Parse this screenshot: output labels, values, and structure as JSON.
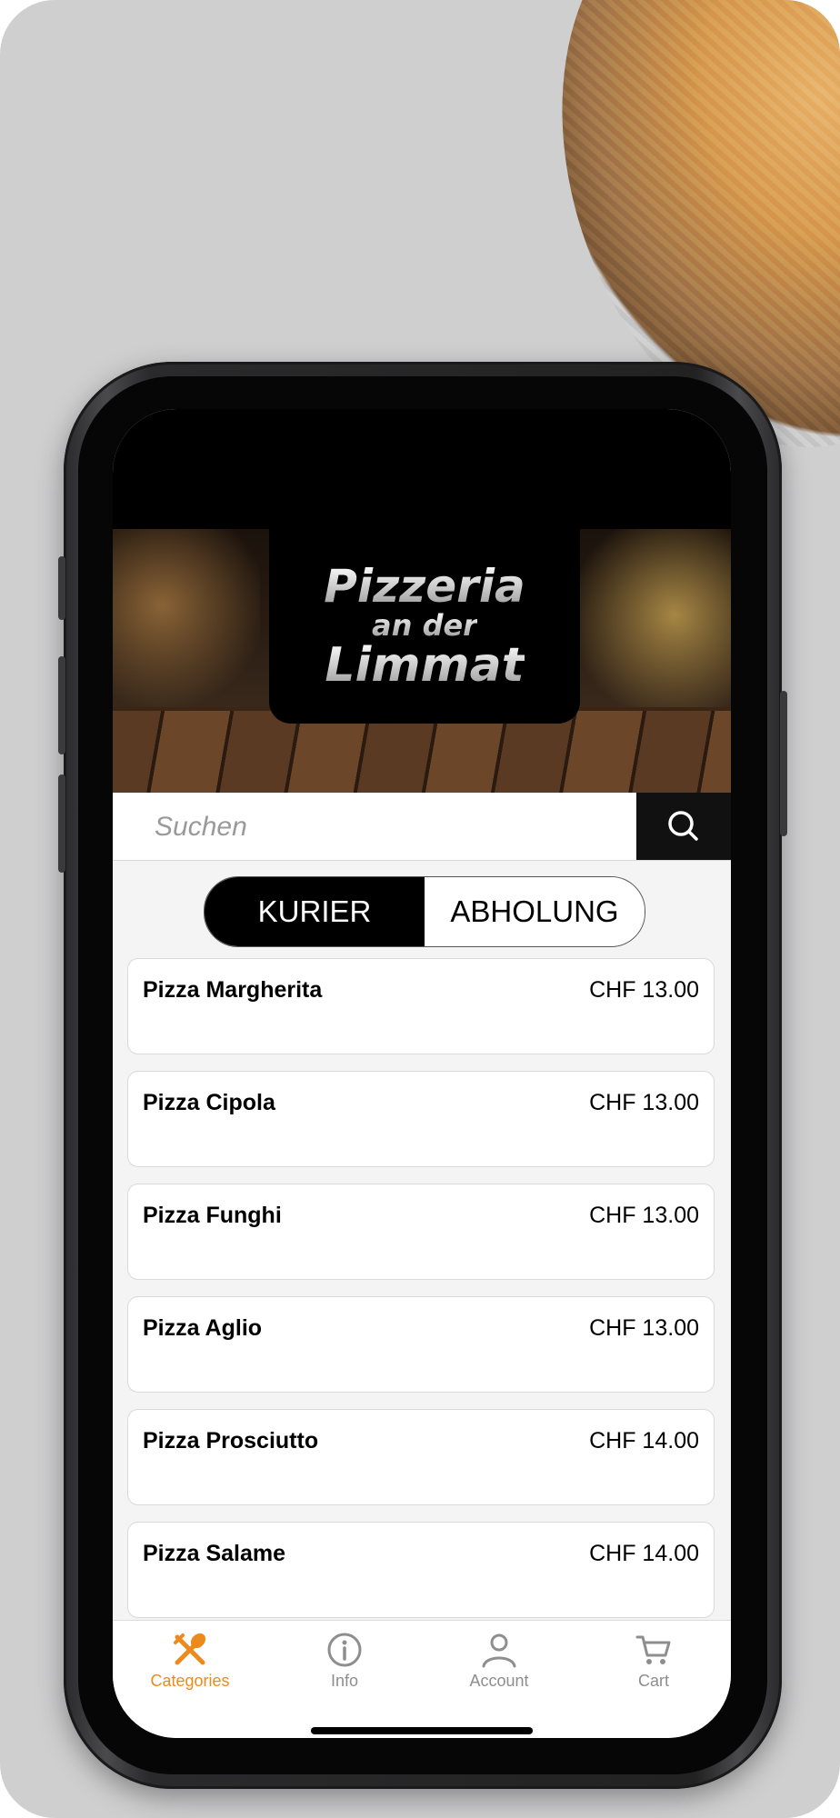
{
  "colors": {
    "accent": "#ec8a1e",
    "inactive_tab": "#8e8e8e",
    "toggle_active_bg": "#000000"
  },
  "brand": {
    "line1": "Pizzeria",
    "line2": "an der",
    "line3": "Limmat"
  },
  "search": {
    "placeholder": "Suchen",
    "value": ""
  },
  "order_mode": {
    "options": [
      "KURIER",
      "ABHOLUNG"
    ],
    "selected": "KURIER"
  },
  "menu_items": [
    {
      "name": "Pizza Margherita",
      "price": "CHF 13.00"
    },
    {
      "name": "Pizza Cipola",
      "price": "CHF 13.00"
    },
    {
      "name": "Pizza Funghi",
      "price": "CHF 13.00"
    },
    {
      "name": "Pizza Aglio",
      "price": "CHF 13.00"
    },
    {
      "name": "Pizza Prosciutto",
      "price": "CHF 14.00"
    },
    {
      "name": "Pizza Salame",
      "price": "CHF 14.00"
    }
  ],
  "tabbar": {
    "tabs": [
      {
        "label": "Categories",
        "icon": "utensils-icon",
        "active": true
      },
      {
        "label": "Info",
        "icon": "info-icon",
        "active": false
      },
      {
        "label": "Account",
        "icon": "user-icon",
        "active": false
      },
      {
        "label": "Cart",
        "icon": "cart-icon",
        "active": false
      }
    ]
  }
}
